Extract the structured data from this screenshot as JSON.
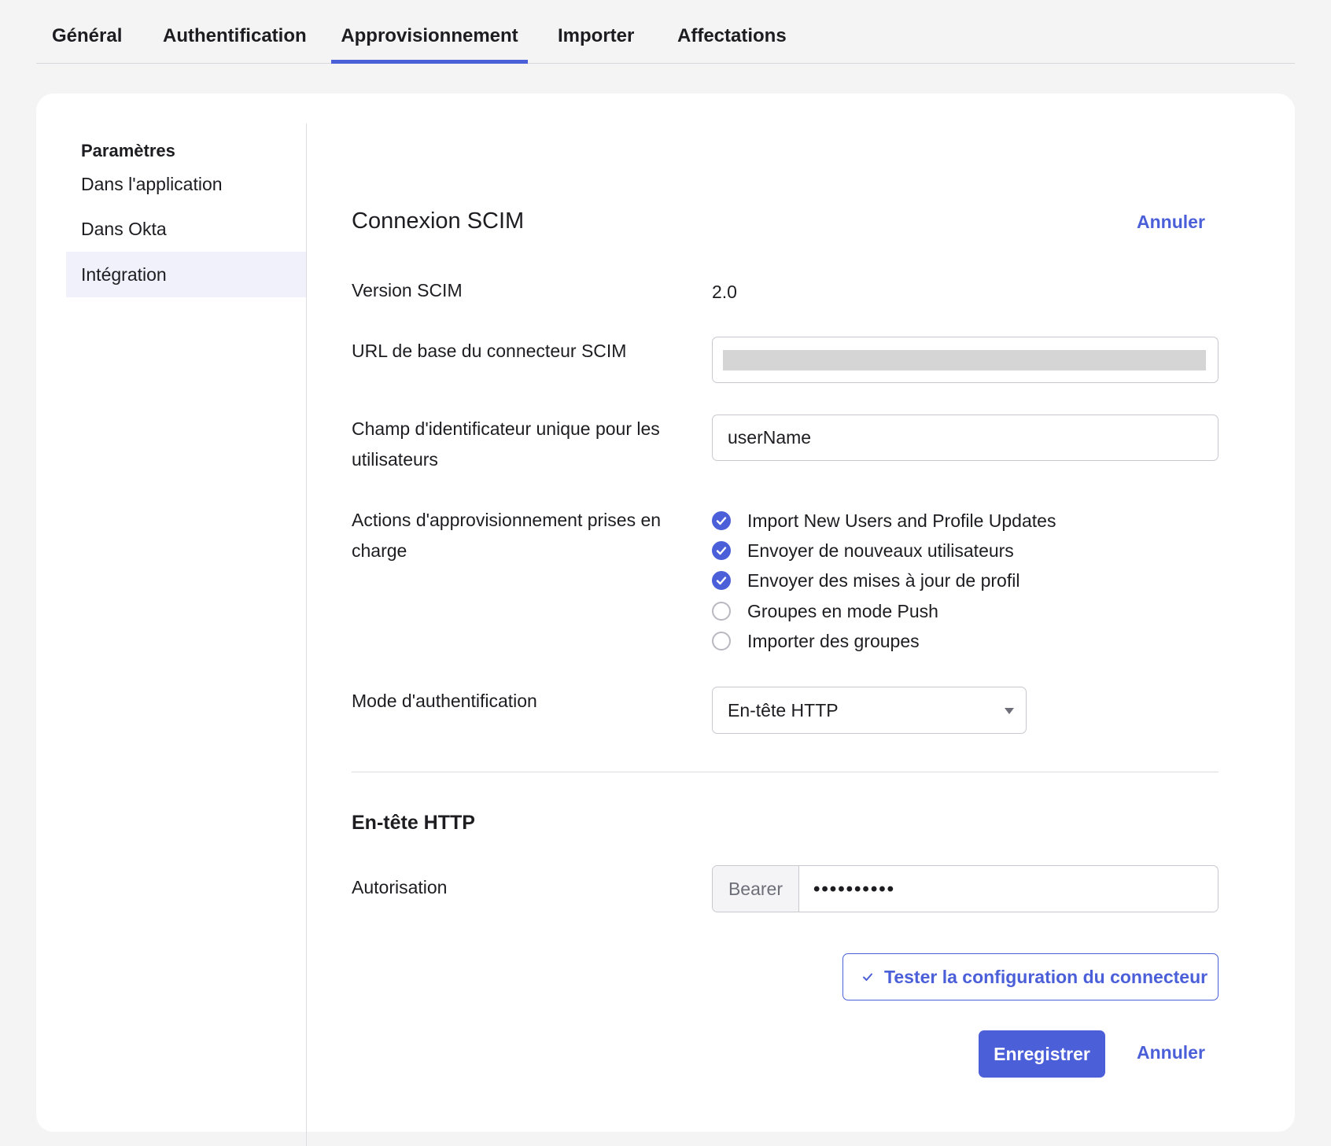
{
  "tabs": [
    {
      "label": "Général"
    },
    {
      "label": "Authentification"
    },
    {
      "label": "Approvisionnement",
      "active": true
    },
    {
      "label": "Importer"
    },
    {
      "label": "Affectations"
    }
  ],
  "sidebar": {
    "title": "Paramètres",
    "items": [
      {
        "label": "Dans l'application"
      },
      {
        "label": "Dans Okta"
      },
      {
        "label": "Intégration",
        "selected": true
      }
    ]
  },
  "scim": {
    "title": "Connexion SCIM",
    "cancel_top": "Annuler",
    "version_label": "Version SCIM",
    "version_value": "2.0",
    "base_url_label": "URL de base du connecteur SCIM",
    "base_url_value": "",
    "unique_id_label": "Champ d'identificateur unique pour les utilisateurs",
    "unique_id_value": "userName",
    "actions_label": "Actions d'approvisionnement prises en charge",
    "actions": [
      {
        "label": "Import New Users and Profile Updates",
        "checked": true
      },
      {
        "label": "Envoyer de nouveaux utilisateurs",
        "checked": true
      },
      {
        "label": "Envoyer des mises à jour de profil",
        "checked": true
      },
      {
        "label": "Groupes en mode Push",
        "checked": false
      },
      {
        "label": "Importer des groupes",
        "checked": false
      }
    ],
    "auth_mode_label": "Mode d'authentification",
    "auth_mode_value": "En-tête HTTP"
  },
  "http_header": {
    "title": "En-tête HTTP",
    "authorization_label": "Autorisation",
    "prefix": "Bearer",
    "token_masked": "••••••••••"
  },
  "actions": {
    "test_button": "Tester la configuration du connecteur",
    "save_button": "Enregistrer",
    "cancel_bottom": "Annuler"
  },
  "colors": {
    "accent": "#4b5fd9",
    "background": "#f4f4f4",
    "card": "#ffffff"
  }
}
